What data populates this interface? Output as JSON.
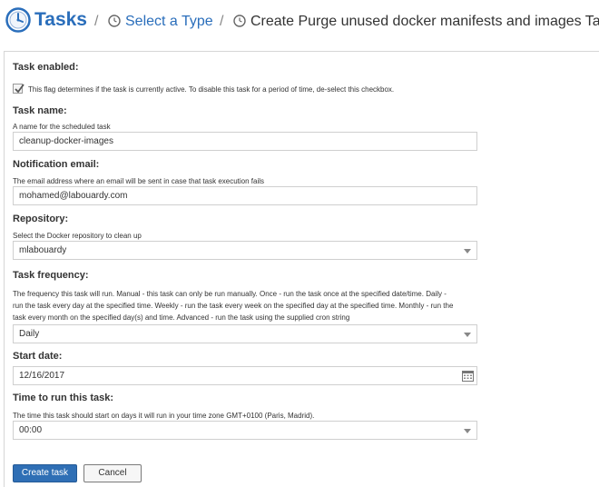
{
  "breadcrumb": {
    "root": "Tasks",
    "separator": "/",
    "step": "Select a Type",
    "current": "Create Purge unused docker manifests and images Task"
  },
  "form": {
    "task_enabled": {
      "label": "Task enabled:",
      "checked": true,
      "help": "This flag determines if the task is currently active. To disable this task for a period of time, de-select this checkbox."
    },
    "task_name": {
      "label": "Task name:",
      "help": "A name for the scheduled task",
      "value": "cleanup-docker-images"
    },
    "notification_email": {
      "label": "Notification email:",
      "help": "The email address where an email will be sent in case that task execution fails",
      "value": "mohamed@labouardy.com"
    },
    "repository": {
      "label": "Repository:",
      "help": "Select the Docker repository to clean up",
      "value": "mlabouardy"
    },
    "task_frequency": {
      "label": "Task frequency:",
      "help_line1": "The frequency this task will run. Manual - this task can only be run manually. Once - run the task once at the specified date/time. Daily -",
      "help_line2": "run the task every day at the specified time. Weekly - run the task every week on the specified day at the specified time. Monthly - run the",
      "help_line3": "task every month on the specified day(s) and time. Advanced - run the task using the supplied cron string",
      "value": "Daily"
    },
    "start_date": {
      "label": "Start date:",
      "value": "12/16/2017"
    },
    "run_time": {
      "label": "Time to run this task:",
      "help": "The time this task should start on days it will run in your time zone GMT+0100 (Paris, Madrid).",
      "value": "00:00"
    }
  },
  "buttons": {
    "create": "Create task",
    "cancel": "Cancel"
  },
  "colors": {
    "accent": "#2a6ebb",
    "primary_button": "#2f6fb5"
  },
  "icons": {
    "header": "clock-icon",
    "calendar": "calendar-icon",
    "dropdown": "chevron-down-icon"
  }
}
